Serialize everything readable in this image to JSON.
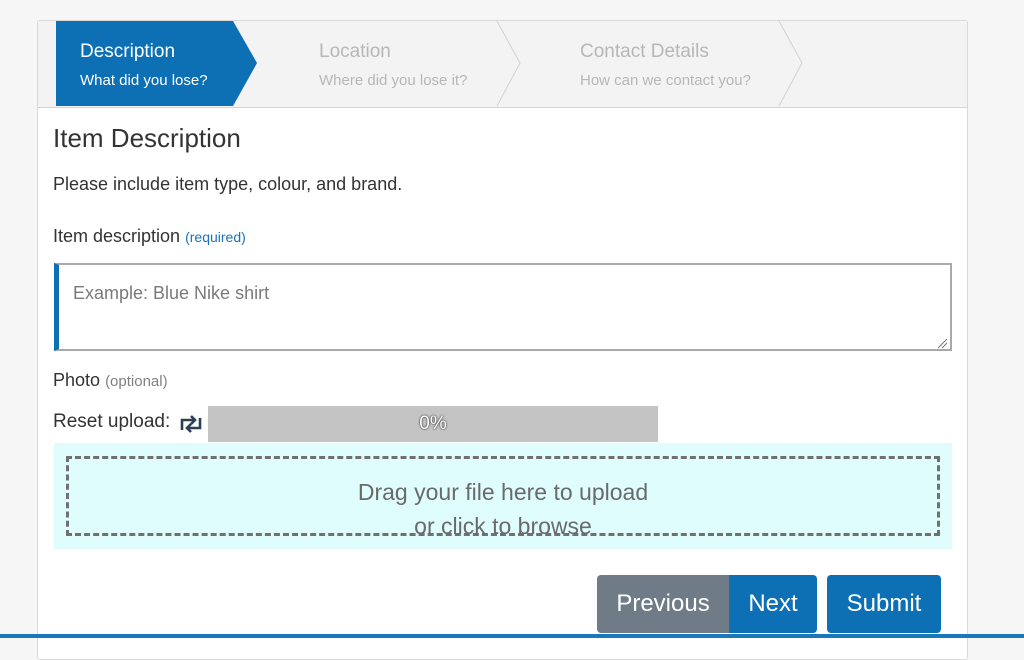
{
  "steps": [
    {
      "title": "Description",
      "subtitle": "What did you lose?",
      "state": "active"
    },
    {
      "title": "Location",
      "subtitle": "Where did you lose it?",
      "state": "inactive"
    },
    {
      "title": "Contact Details",
      "subtitle": "How can we contact you?",
      "state": "inactive"
    }
  ],
  "section": {
    "title": "Item Description",
    "help": "Please include item type, colour, and brand."
  },
  "description_field": {
    "label": "Item description",
    "required": "(required)",
    "placeholder": "Example: Blue Nike shirt",
    "value": ""
  },
  "photo": {
    "label": "Photo",
    "optional": "(optional)",
    "reset_label": "Reset upload:",
    "reset_icon": "retweet-icon",
    "progress_text": "0%",
    "progress_percent": 0,
    "dropzone_line1": "Drag your file here to upload",
    "dropzone_line2": "or click to browse"
  },
  "buttons": {
    "previous": "Previous",
    "next": "Next",
    "submit": "Submit"
  },
  "colors": {
    "primary": "#0d6fb4",
    "secondary_button": "#6f7c87",
    "dropzone_bg": "#dffdfd",
    "progress_track": "#c4c4c4"
  }
}
